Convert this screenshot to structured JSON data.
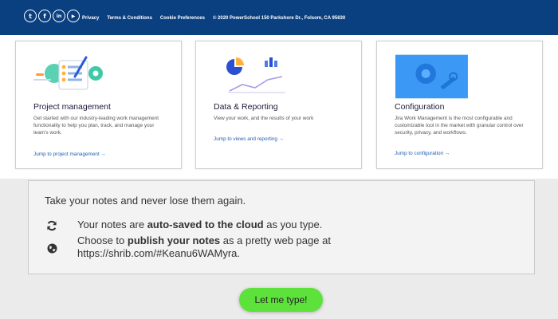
{
  "footer_bar": {
    "social": [
      {
        "icon": "twitter-icon",
        "glyph": "t"
      },
      {
        "icon": "facebook-icon",
        "glyph": "f"
      },
      {
        "icon": "linkedin-icon",
        "glyph": "in"
      },
      {
        "icon": "youtube-icon",
        "glyph": "▶"
      }
    ],
    "links": [
      "Privacy",
      "Terms & Conditions",
      "Cookie Preferences"
    ],
    "copyright": "© 2020 PowerSchool 150 Parkshore Dr., Folsom, CA 95630",
    "background": "#0b4080"
  },
  "cards": [
    {
      "title": "Project management",
      "description": "Get started with our industry-leading work management functionality to help you plan, track, and manage your team's work.",
      "link": "Jump to project management →",
      "illustration": "project-management-illustration"
    },
    {
      "title": "Data & Reporting",
      "description": "View your work, and the results of your work",
      "link": "Jump to views and reporting →",
      "illustration": "data-reporting-illustration"
    },
    {
      "title": "Configuration",
      "description": "Jira Work Management is the most configurable and customizable tool in the market with granular control over security, privacy, and workflows.",
      "link": "Jump to configuration →",
      "illustration": "configuration-illustration"
    }
  ],
  "notes": {
    "heading": "Take your notes and never lose them again.",
    "features": [
      {
        "icon": "sync-icon",
        "pre": "Your notes are ",
        "bold": "auto-saved to the cloud",
        "post": " as you type."
      },
      {
        "icon": "globe-icon",
        "pre": "Choose to ",
        "bold": "publish your notes",
        "post": " as a pretty web page at https://shrib.com/#Keanu6WAMyra."
      }
    ]
  },
  "cta": {
    "label": "Let me type!",
    "color": "#5ce23a"
  }
}
